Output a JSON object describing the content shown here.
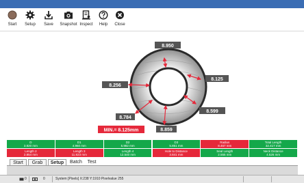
{
  "toolbar": {
    "items": [
      {
        "label": "Start",
        "icon": "start-circle-icon"
      },
      {
        "label": "Setup",
        "icon": "gear-icon"
      },
      {
        "label": "Save",
        "icon": "save-download-icon"
      },
      {
        "label": "Snapshot",
        "icon": "camera-icon"
      },
      {
        "label": "Inspect",
        "icon": "inspect-report-icon"
      },
      {
        "label": "Help",
        "icon": "help-icon"
      },
      {
        "label": "Close",
        "icon": "close-icon"
      }
    ]
  },
  "measurements": {
    "outer_top": "8.950",
    "outer_right": "8.125",
    "left": "8.256",
    "lower_right": "8.599",
    "lower_left": "8.784",
    "bottom": "8.859",
    "min_label": "MIN.= 8.125mm"
  },
  "results_row1": [
    {
      "name": "D",
      "value": "3.820 mm",
      "status": "ok"
    },
    {
      "name": "D1",
      "value": "4.960 mm",
      "status": "ok"
    },
    {
      "name": "D2",
      "value": "5.982 mm",
      "status": "ok"
    },
    {
      "name": "D3",
      "value": "5.851 mm",
      "status": "ok"
    },
    {
      "name": "Radius",
      "value": "8.467 mm",
      "status": "fail"
    },
    {
      "name": "Total Length",
      "value": "32.417 mm",
      "status": "ok"
    }
  ],
  "results_row2": [
    {
      "name": "Length 2",
      "value": "2.854 mm",
      "status": "fail"
    },
    {
      "name": "Length 3",
      "value": "11.823 mm",
      "status": "fail"
    },
    {
      "name": "Length 4",
      "value": "12.540 mm",
      "status": "ok"
    },
    {
      "name": "Hole to Distance",
      "value": "3.841 mm",
      "status": "fail"
    },
    {
      "name": "Seal Length",
      "value": "2.555 mm",
      "status": "ok"
    },
    {
      "name": "Neck Distance",
      "value": "4.526 mm",
      "status": "ok"
    }
  ],
  "colors": {
    "ok": "#14a84a",
    "fail": "#e5283a",
    "accent": "#3a6db4"
  },
  "tabs": [
    {
      "label": "Start",
      "active": false
    },
    {
      "label": "Grab",
      "active": false
    },
    {
      "label": "Setup",
      "active": true
    },
    {
      "label": "Batch",
      "active": false
    },
    {
      "label": "Test",
      "active": false
    }
  ],
  "status": {
    "counter1": "0",
    "counter2": "0",
    "text": "System  [Pixels] X:238 Y:1910 Pixelvalue 255"
  }
}
